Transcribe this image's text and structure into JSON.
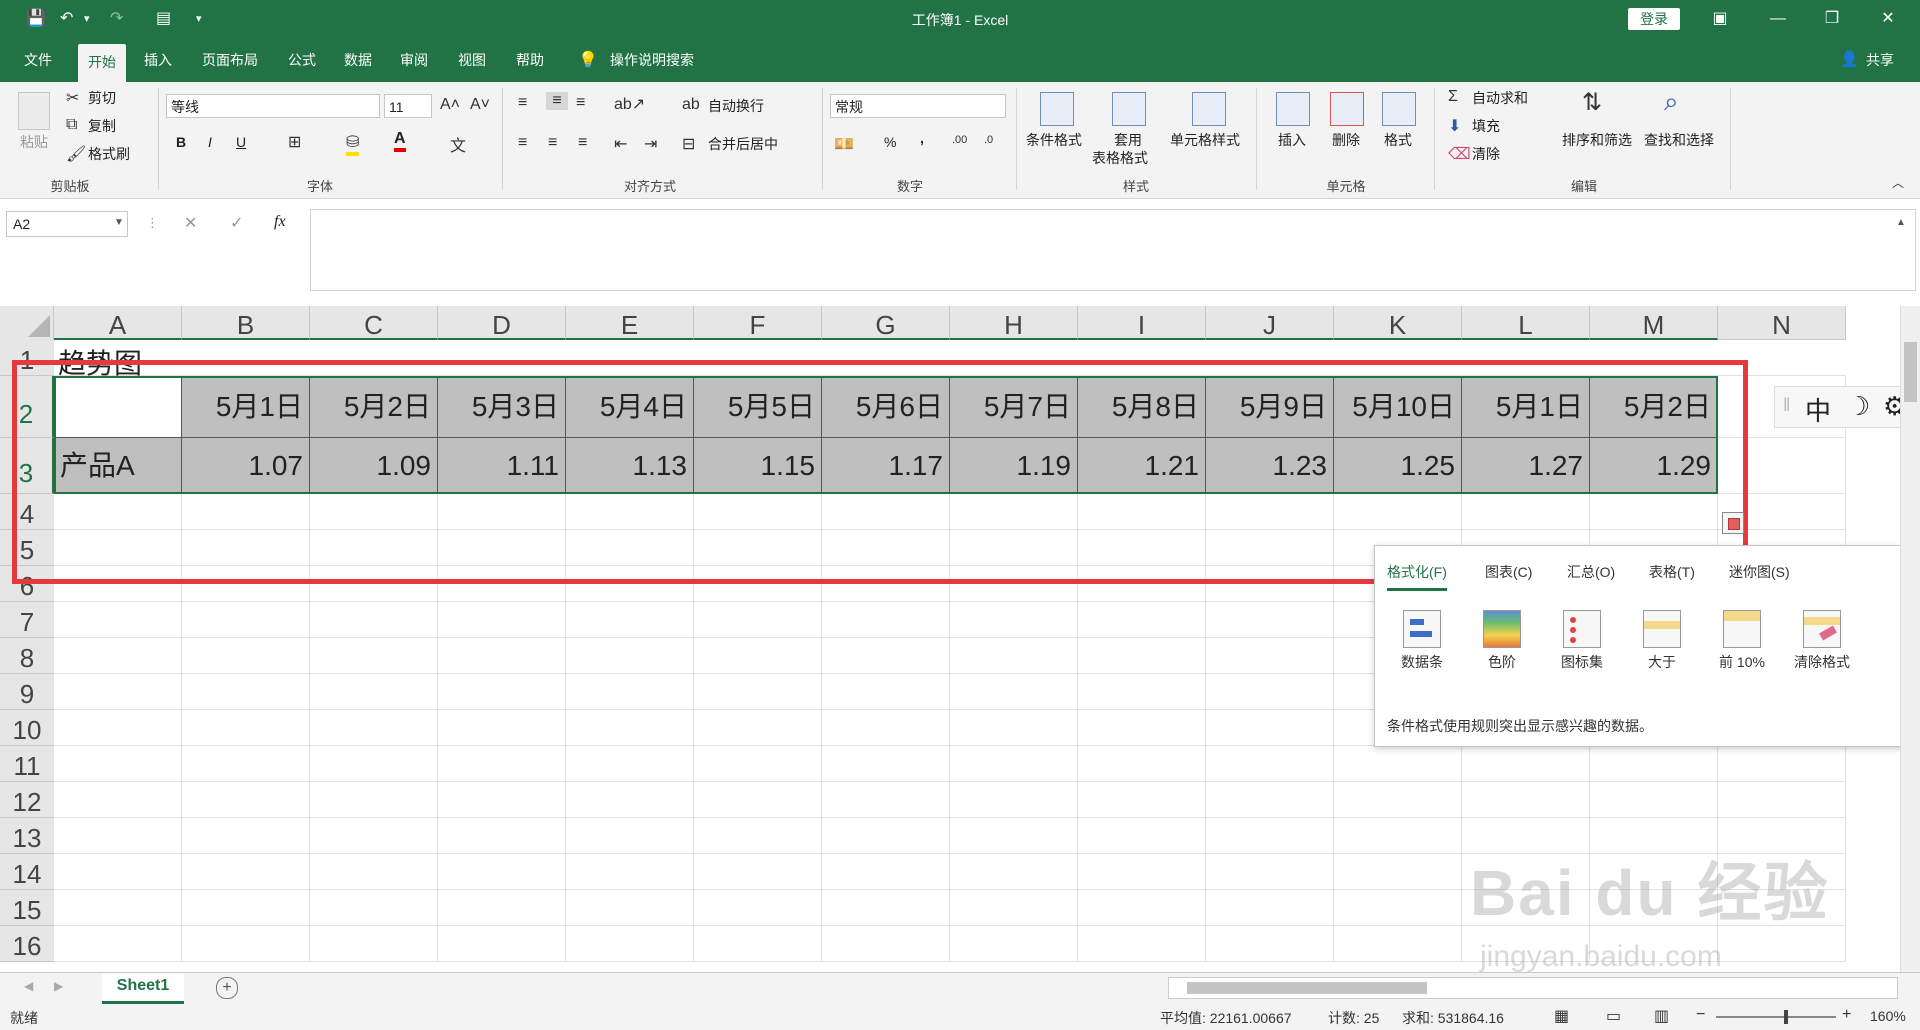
{
  "titlebar": {
    "title": "工作簿1  -  Excel",
    "login": "登录",
    "minimize": "—",
    "restore": "❐",
    "close": "✕"
  },
  "tabs": [
    "文件",
    "开始",
    "插入",
    "页面布局",
    "公式",
    "数据",
    "审阅",
    "视图",
    "帮助"
  ],
  "tell_me": "操作说明搜索",
  "share": "共享",
  "ribbon": {
    "clipboard": {
      "paste": "粘贴",
      "cut": "剪切",
      "copy": "复制",
      "format_painter": "格式刷",
      "label": "剪贴板"
    },
    "font": {
      "name": "等线",
      "size": "11",
      "bold": "B",
      "italic": "I",
      "underline": "U",
      "label": "字体"
    },
    "alignment": {
      "wrap": "自动换行",
      "merge": "合并后居中",
      "label": "对齐方式"
    },
    "number": {
      "format": "常规",
      "percent": "%",
      "comma": ",",
      "label": "数字"
    },
    "styles": {
      "conditional": "条件格式",
      "table_format_1": "套用",
      "table_format_2": "表格格式",
      "cell_styles": "单元格样式",
      "label": "样式"
    },
    "cells": {
      "insert": "插入",
      "delete": "删除",
      "format": "格式",
      "label": "单元格"
    },
    "editing": {
      "autosum": "自动求和",
      "fill": "填充",
      "clear": "清除",
      "sort_filter": "排序和筛选",
      "find_select": "查找和选择",
      "label": "编辑"
    }
  },
  "formula_bar": {
    "name_box": "A2",
    "fx": "fx",
    "cancel": "✕",
    "enter": "✓",
    "formula": ""
  },
  "columns": [
    "A",
    "B",
    "C",
    "D",
    "E",
    "F",
    "G",
    "H",
    "I",
    "J",
    "K",
    "L",
    "M",
    "N"
  ],
  "rows": [
    "1",
    "2",
    "3",
    "4",
    "5",
    "6",
    "7",
    "8",
    "9",
    "10",
    "11",
    "12",
    "13",
    "14",
    "15",
    "16"
  ],
  "cells": {
    "A1": "趋势图",
    "row2": [
      "",
      "5月1日",
      "5月2日",
      "5月3日",
      "5月4日",
      "5月5日",
      "5月6日",
      "5月7日",
      "5月8日",
      "5月9日",
      "5月10日",
      "5月1日",
      "5月2日"
    ],
    "row3": [
      "产品A",
      "1.07",
      "1.09",
      "1.11",
      "1.13",
      "1.15",
      "1.17",
      "1.19",
      "1.21",
      "1.23",
      "1.25",
      "1.27",
      "1.29"
    ]
  },
  "ime_bar": {
    "lang": "中"
  },
  "quick_analysis": {
    "tabs": [
      "格式化(F)",
      "图表(C)",
      "汇总(O)",
      "表格(T)",
      "迷你图(S)"
    ],
    "items": [
      "数据条",
      "色阶",
      "图标集",
      "大于",
      "前 10%",
      "清除格式"
    ],
    "description": "条件格式使用规则突出显示感兴趣的数据。"
  },
  "sheet_tabs": {
    "active": "Sheet1",
    "add": "+"
  },
  "status": {
    "ready": "就绪",
    "average": "平均值: 22161.00667",
    "count": "计数: 25",
    "sum": "求和: 531864.16",
    "zoom": "160%"
  },
  "watermark": {
    "main": "Bai du 经验",
    "sub": "jingyan.baidu.com"
  },
  "colors": {
    "accent": "#217346",
    "highlight_box": "#e8393a",
    "selection_fill": "#bfbfbf"
  }
}
